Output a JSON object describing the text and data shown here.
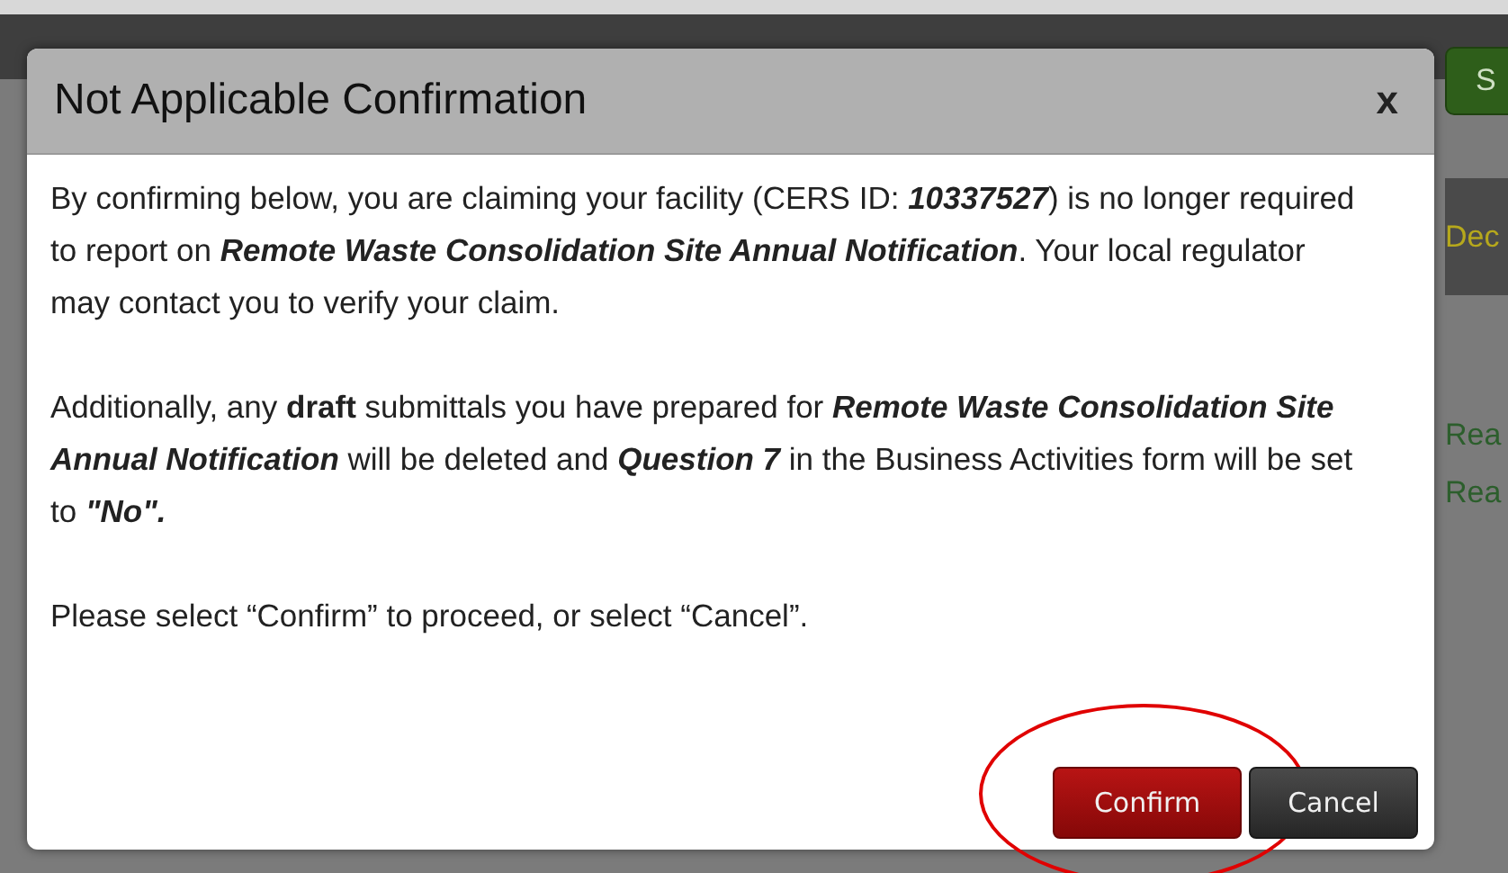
{
  "background": {
    "button": "S",
    "heading": "Dec",
    "links": [
      "Rea",
      "Rea"
    ]
  },
  "dialog": {
    "title": "Not Applicable Confirmation",
    "close": "x",
    "paragraphs": [
      "By confirming below, you are claiming your facility (CERS ID: *10337527*) is no longer required to report on *Remote Waste Consolidation Site Annual Notification*. Your local regulator may contact you to verify your claim.",
      "Additionally, any **draft** submittals you have prepared for *Remote Waste Consolidation Site Annual Notification* will be deleted and *Question 7* in the Business Activities form will be set to *\"No\".*",
      "Please select “Confirm” to proceed, or select “Cancel”."
    ],
    "buttons": [
      {
        "label": "Confirm",
        "kind": "primary",
        "circled": true
      },
      {
        "label": "Cancel",
        "kind": "secondary",
        "circled": false
      }
    ]
  }
}
